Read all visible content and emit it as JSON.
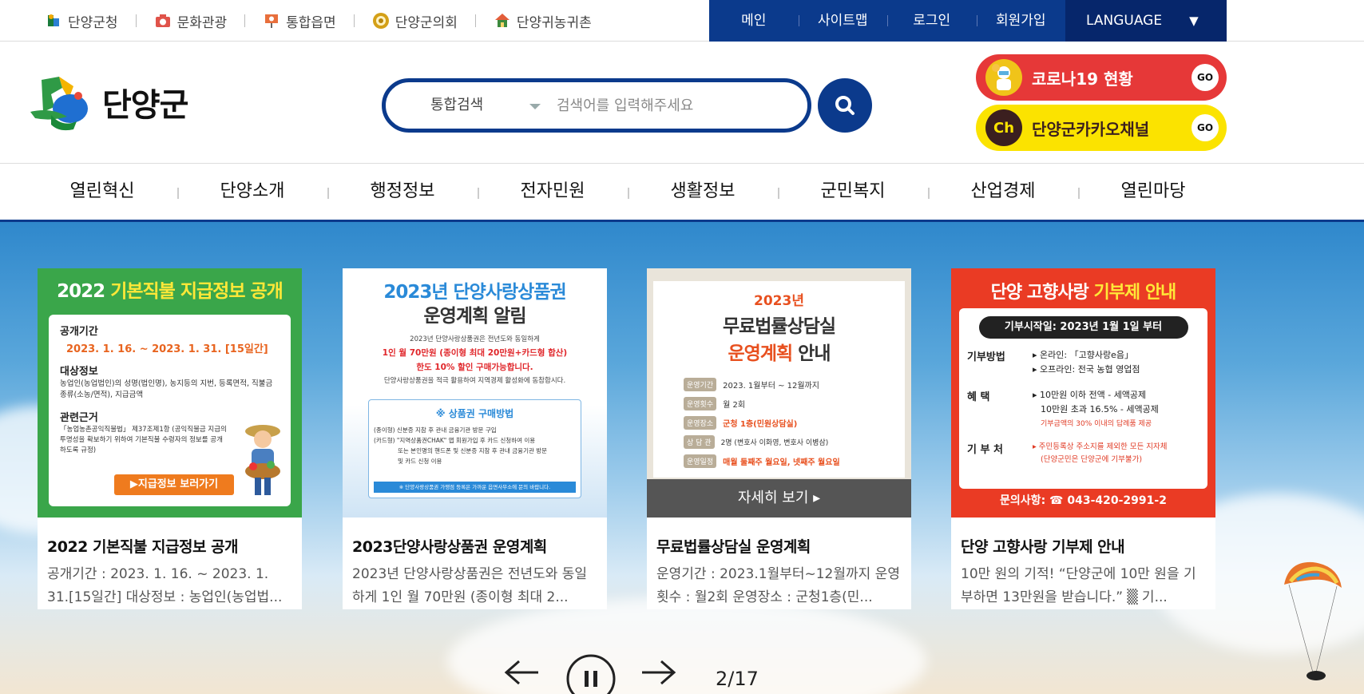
{
  "family_sites": [
    {
      "label": "단양군청",
      "icon": "county-office-icon"
    },
    {
      "label": "문화관광",
      "icon": "camera-icon"
    },
    {
      "label": "통합읍면",
      "icon": "location-pin-icon"
    },
    {
      "label": "단양군의회",
      "icon": "council-emblem-icon"
    },
    {
      "label": "단양귀농귀촌",
      "icon": "farm-house-icon"
    }
  ],
  "util_menu": [
    "메인",
    "사이트맵",
    "로그인",
    "회원가입"
  ],
  "language": {
    "label": "LANGUAGE",
    "arrow": "▼"
  },
  "logo": {
    "text": "단양군"
  },
  "search": {
    "category": "통합검색",
    "placeholder": "검색어를 입력해주세요",
    "button_icon": "search-icon"
  },
  "promos": [
    {
      "label": "코로나19 현황",
      "go": "GO",
      "icon": "covid-worker-icon",
      "color": "#e63838"
    },
    {
      "label": "단양군카카오채널",
      "go": "GO",
      "icon_text": "Ch",
      "color": "#fbe300"
    }
  ],
  "gnb": [
    "열린혁신",
    "단양소개",
    "행정정보",
    "전자민원",
    "생활정보",
    "군민복지",
    "산업경제",
    "열린마당"
  ],
  "cards": [
    {
      "title": "2022 기본직불 지급정보 공개",
      "desc": "공개기간 : 2023. 1. 16. ~ 2023. 1. 31.[15일간] 대상정보 : 농업인(농업법...",
      "poster": {
        "heading_a": "2022 ",
        "heading_b": "기본직불 지급정보 공개",
        "sections": [
          {
            "label": "공개기간",
            "body": "2023. 1. 16. ~ 2023. 1. 31. [15일간]"
          },
          {
            "label": "대상정보",
            "body": "농업인(농업법인)의 성명(법인명), 농지등의 지번, 등록면적, 직불금 종류(소농/면적), 지급금액"
          },
          {
            "label": "관련근거",
            "body": "「농업농촌공익직불법」 제37조제1항 (공익직불금 지급의 투명성을 확보하기 위하여 기본직불 수령자의 정보를 공개하도록 규정)"
          }
        ],
        "cta": "▶지급정보 보러가기"
      }
    },
    {
      "title": "2023단양사랑상품권 운영계획",
      "desc": "2023년 단양사랑상품권은 전년도와 동일하게 1인 월 70만원 (종이형 최대 2...",
      "poster": {
        "heading_1": "2023년 단양사랑상품권",
        "heading_2": "운영계획 알림",
        "line1": "2023년 단양사랑상품권은 전년도와 동일하게",
        "line2": "1인 월 70만원 (종이형 최대 20만원+카드형 합산)",
        "line3": "한도 10% 할인 구매가능합니다.",
        "line4": "단양사랑상품권을 적극 활용하여 지역경제 활성화에 동참합시다.",
        "box_title": "※ 상품권 구매방법",
        "box_1": "(종이형) 신분증 지참 후 관내 금융기관 방문 구입",
        "box_2": "(카드형) \"지역상품권CHAK\" 앱 회원가입 후 카드 신청하여 이용",
        "box_3": "또는 본인명의 핸드폰 및 신분증 지참 후 관내 금융기관 방문",
        "box_4": "및 카드 신청 이용",
        "footer": "※ 단양사랑상품권 가맹점 등록은 가까운 읍면사무소에 문의 바랍니다."
      }
    },
    {
      "title": "무료법률상담실 운영계획",
      "desc": "운영기간 : 2023.1월부터~12월까지 운영횟수 : 월2회 운영장소 : 군청1층(민...",
      "poster": {
        "year": "2023년",
        "heading_1": "무료법률상담실",
        "heading_2a": "운영계획",
        "heading_2b": " 안내",
        "rows": [
          {
            "k": "운영기간",
            "v": "2023. 1월부터 ~ 12월까지"
          },
          {
            "k": "운영횟수",
            "v": "월 2회"
          },
          {
            "k": "운영장소",
            "v": "군청 1층(민원상담실)"
          },
          {
            "k": "상 담 관",
            "v": "2명 (변호사 이화영, 변호사 이병삼)"
          },
          {
            "k": "운영일정",
            "v": "매월 둘째주 월요일, 넷째주 월요일"
          }
        ],
        "more": "자세히 보기 ▸"
      }
    },
    {
      "title": "단양 고향사랑 기부제 안내",
      "desc": "10만 원의 기적! “단양군에 10만 원을 기부하면 13만원을 받습니다.” ▒ 기...",
      "poster": {
        "heading_a": "단양 고향사랑 ",
        "heading_b": "기부제 안내",
        "start": "기부시작일: 2023년 1월 1일 부터",
        "method_label": "기부방법",
        "method_1": "▸ 온라인: 「고향사랑e음」",
        "method_2": "▸ 오프라인: 전국 농협 영업점",
        "benefit_label": "혜    택",
        "benefit_1": "▸ 10만원 이하 전액 - 세액공제",
        "benefit_2": "10만원 초과 16.5% - 세액공제",
        "benefit_3": "기부금액의 30% 이내의 답례품 제공",
        "target_label": "기 부 처",
        "target_1": "▸ 주민등록상 주소지를 제외한 모든 지자체",
        "target_2": "(단양군민은 단양군에 기부불가)",
        "contact": "문의사항: ☎ 043-420-2991-2"
      }
    }
  ],
  "slider": {
    "pager": "2/17",
    "prev_icon": "arrow-left-icon",
    "pause_icon": "pause-icon",
    "next_icon": "arrow-right-icon"
  }
}
